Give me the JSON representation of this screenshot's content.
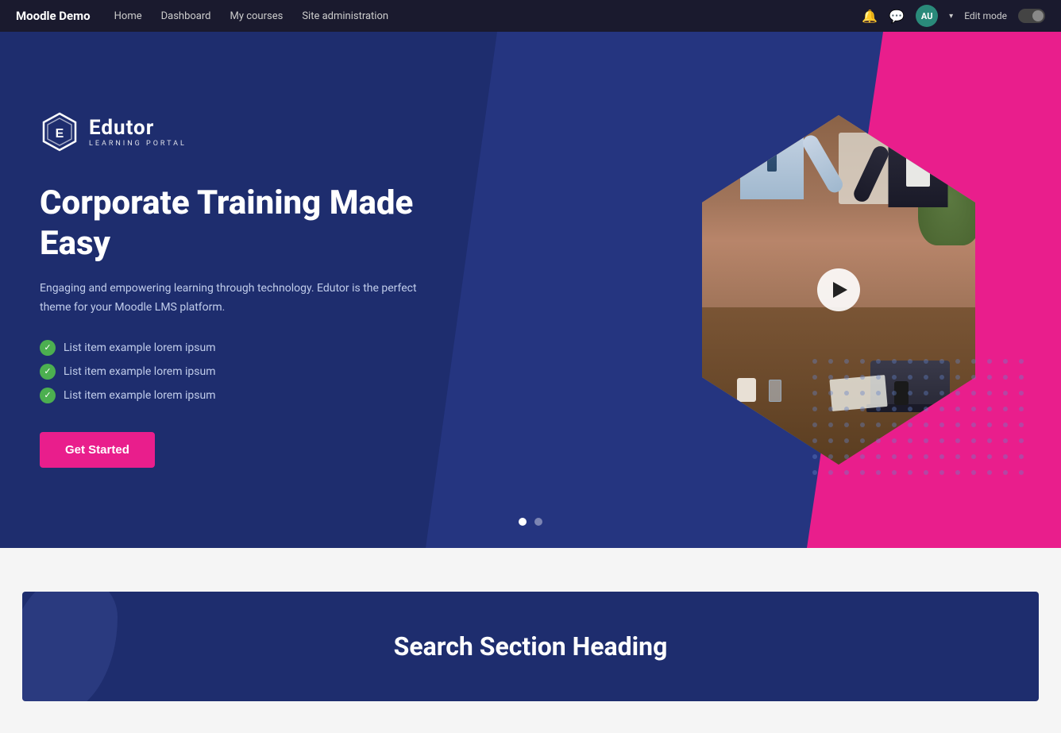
{
  "navbar": {
    "brand": "Moodle Demo",
    "links": [
      {
        "label": "Home",
        "id": "home"
      },
      {
        "label": "Dashboard",
        "id": "dashboard"
      },
      {
        "label": "My courses",
        "id": "my-courses"
      },
      {
        "label": "Site administration",
        "id": "site-admin"
      }
    ],
    "avatar_initials": "AU",
    "edit_mode_label": "Edit mode"
  },
  "hero": {
    "logo_name": "Edutor",
    "logo_sub": "LEARNING PORTAL",
    "title": "Corporate Training Made Easy",
    "description": "Engaging and empowering learning through technology. Edutor is the perfect theme for your Moodle LMS platform.",
    "list_items": [
      "List item example lorem ipsum",
      "List item example lorem ipsum",
      "List item example lorem ipsum"
    ],
    "cta_button": "Get Started",
    "carousel_dots": [
      {
        "active": true
      },
      {
        "active": false
      }
    ]
  },
  "search_section": {
    "heading": "Search Section Heading"
  }
}
